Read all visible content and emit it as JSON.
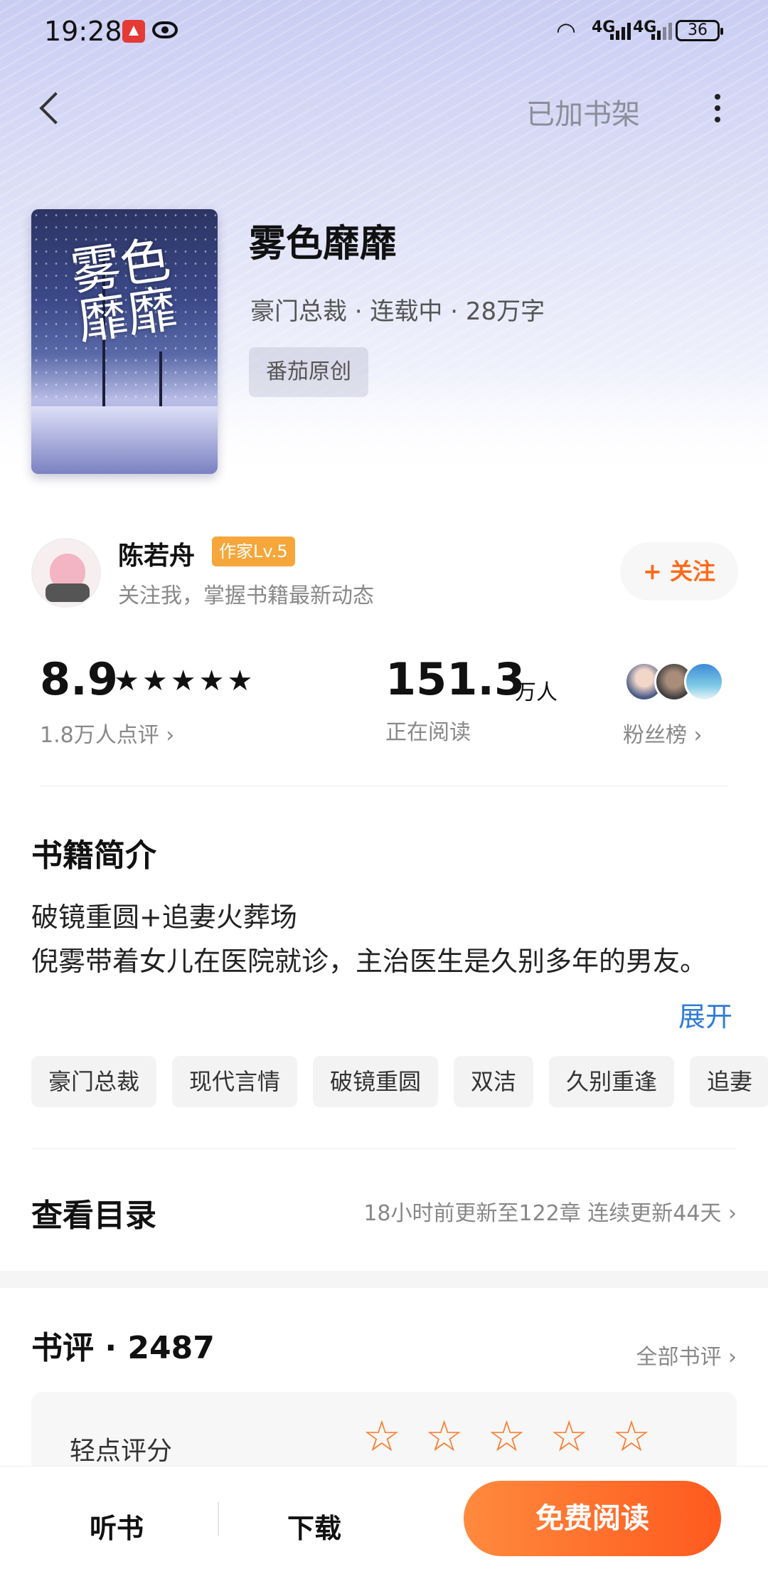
{
  "status_bar": {
    "time": "19:28",
    "network1": "4G",
    "network2": "4G",
    "battery": "36"
  },
  "nav": {
    "shelf_label": "已加书架"
  },
  "book": {
    "title": "雾色靡靡",
    "cover_title_art": "雾色靡靡",
    "meta": "豪门总裁 · 连载中 · 28万字",
    "tag": "番茄原创"
  },
  "author": {
    "name": "陈若舟",
    "level": "作家Lv.5",
    "desc": "关注我，掌握书籍最新动态",
    "follow_label": "+ 关注"
  },
  "stats": {
    "rating": "8.9",
    "stars": "★★★★★",
    "rating_count": "1.8万人点评 ›",
    "readers": "151.3",
    "readers_unit": "万人",
    "readers_label": "正在阅读",
    "fans_label": "粉丝榜 ›"
  },
  "intro": {
    "title": "书籍简介",
    "line1": "破镜重圆+追妻火葬场",
    "line2": "倪雾带着女儿在医院就诊，主治医生是久别多年的男友。",
    "expand": "展开",
    "tags": [
      "豪门总裁",
      "现代言情",
      "破镜重圆",
      "双洁",
      "久别重逢",
      "追妻"
    ]
  },
  "catalog": {
    "title": "查看目录",
    "info": "18小时前更新至122章 连续更新44天 ›"
  },
  "reviews": {
    "title": "书评 · 2487",
    "all_label": "全部书评 ›",
    "rate_label": "轻点评分",
    "rate_stars": "☆☆☆☆☆"
  },
  "bottom": {
    "listen": "听书",
    "download": "下载",
    "read": "免费阅读"
  },
  "colors": {
    "accent": "#ff6a1a",
    "link": "#2f7bd8",
    "level_badge": "#f6a63b"
  }
}
